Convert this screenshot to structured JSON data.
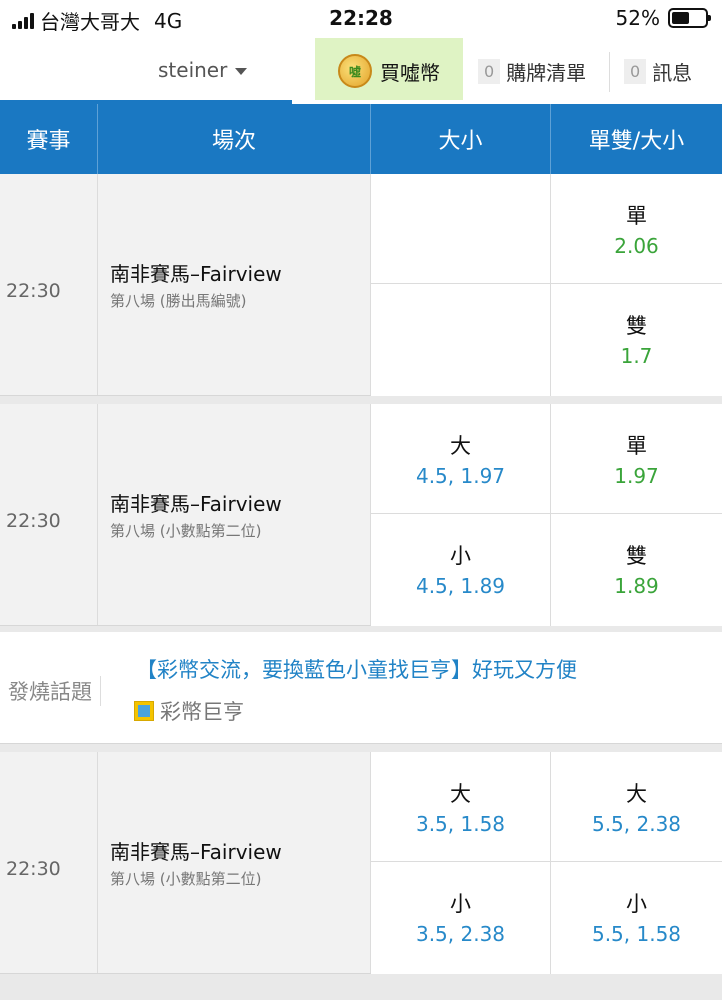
{
  "status_bar": {
    "carrier": "台灣大哥大",
    "network": "4G",
    "time": "22:28",
    "battery_percent": "52%",
    "battery_level": 0.52
  },
  "nav": {
    "username": "steiner",
    "coin_button": "買噓幣",
    "coin_icon_text": "噓",
    "cart": {
      "count": "0",
      "label": "購牌清單"
    },
    "messages": {
      "count": "0",
      "label": "訊息"
    }
  },
  "table": {
    "headers": [
      "賽事",
      "場次",
      "大小",
      "單雙/大小"
    ]
  },
  "blocks": [
    {
      "time": "22:30",
      "title": "南非賽馬–Fairview",
      "subtitle": "第八場 (勝出馬編號)",
      "col3": [
        {
          "label": "",
          "value": ""
        },
        {
          "label": "",
          "value": ""
        }
      ],
      "col4": [
        {
          "label": "單",
          "value": "2.06"
        },
        {
          "label": "雙",
          "value": "1.7"
        }
      ]
    },
    {
      "time": "22:30",
      "title": "南非賽馬–Fairview",
      "subtitle": "第八場 (小數點第二位)",
      "col3": [
        {
          "label": "大",
          "value": "4.5, 1.97"
        },
        {
          "label": "小",
          "value": "4.5, 1.89"
        }
      ],
      "col4": [
        {
          "label": "單",
          "value": "1.97"
        },
        {
          "label": "雙",
          "value": "1.89"
        }
      ]
    },
    {
      "time": "22:30",
      "title": "南非賽馬–Fairview",
      "subtitle": "第八場 (小數點第二位)",
      "col3": [
        {
          "label": "大",
          "value": "3.5, 1.58"
        },
        {
          "label": "小",
          "value": "3.5, 2.38"
        }
      ],
      "col4": [
        {
          "label": "大",
          "value": "5.5, 2.38"
        },
        {
          "label": "小",
          "value": "5.5, 1.58"
        }
      ]
    }
  ],
  "hot_topic": {
    "label": "發燒話題",
    "title": "【彩幣交流，要換藍色小童找巨亨】好玩又方便",
    "author": "彩幣巨亨"
  },
  "colors": {
    "header_blue": "#1a78c2",
    "odds_green": "#3aa43a",
    "odds_blue": "#2789c9",
    "coin_highlight": "#dff3c4"
  }
}
